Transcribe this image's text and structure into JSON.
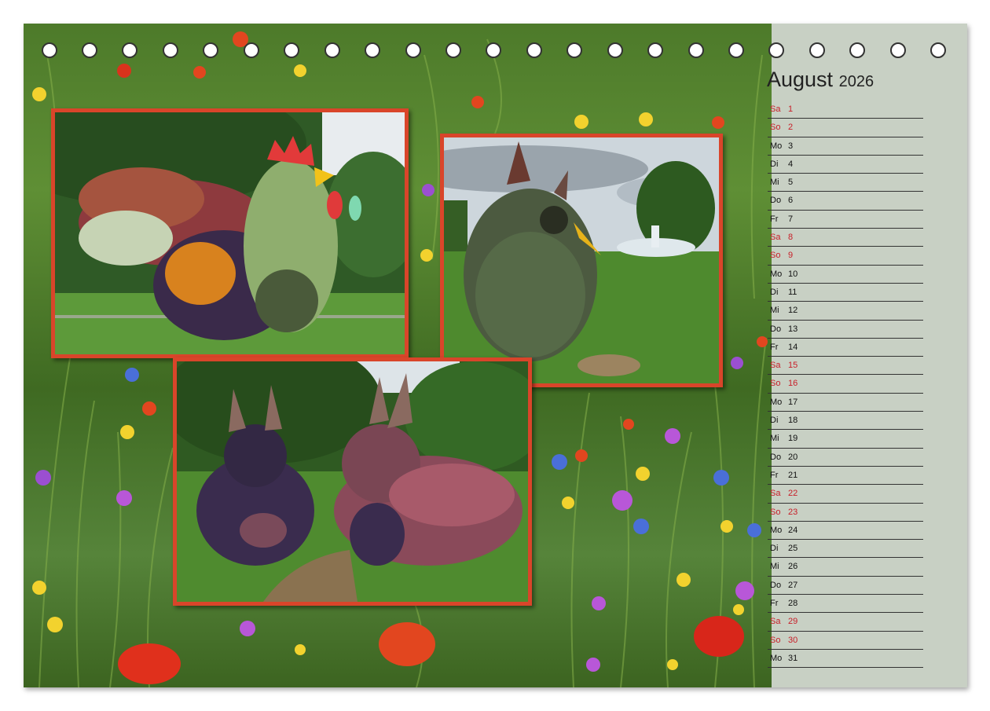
{
  "calendar": {
    "month": "August",
    "year": "2026",
    "days": [
      {
        "dn": "Sa",
        "d": "1",
        "weekend": true
      },
      {
        "dn": "So",
        "d": "2",
        "weekend": true
      },
      {
        "dn": "Mo",
        "d": "3",
        "weekend": false
      },
      {
        "dn": "Di",
        "d": "4",
        "weekend": false
      },
      {
        "dn": "Mi",
        "d": "5",
        "weekend": false
      },
      {
        "dn": "Do",
        "d": "6",
        "weekend": false
      },
      {
        "dn": "Fr",
        "d": "7",
        "weekend": false
      },
      {
        "dn": "Sa",
        "d": "8",
        "weekend": true
      },
      {
        "dn": "So",
        "d": "9",
        "weekend": true
      },
      {
        "dn": "Mo",
        "d": "10",
        "weekend": false
      },
      {
        "dn": "Di",
        "d": "11",
        "weekend": false
      },
      {
        "dn": "Mi",
        "d": "12",
        "weekend": false
      },
      {
        "dn": "Do",
        "d": "13",
        "weekend": false
      },
      {
        "dn": "Fr",
        "d": "14",
        "weekend": false
      },
      {
        "dn": "Sa",
        "d": "15",
        "weekend": true
      },
      {
        "dn": "So",
        "d": "16",
        "weekend": true
      },
      {
        "dn": "Mo",
        "d": "17",
        "weekend": false
      },
      {
        "dn": "Di",
        "d": "18",
        "weekend": false
      },
      {
        "dn": "Mi",
        "d": "19",
        "weekend": false
      },
      {
        "dn": "Do",
        "d": "20",
        "weekend": false
      },
      {
        "dn": "Fr",
        "d": "21",
        "weekend": false
      },
      {
        "dn": "Sa",
        "d": "22",
        "weekend": true
      },
      {
        "dn": "So",
        "d": "23",
        "weekend": true
      },
      {
        "dn": "Mo",
        "d": "24",
        "weekend": false
      },
      {
        "dn": "Di",
        "d": "25",
        "weekend": false
      },
      {
        "dn": "Mi",
        "d": "26",
        "weekend": false
      },
      {
        "dn": "Do",
        "d": "27",
        "weekend": false
      },
      {
        "dn": "Fr",
        "d": "28",
        "weekend": false
      },
      {
        "dn": "Sa",
        "d": "29",
        "weekend": true
      },
      {
        "dn": "So",
        "d": "30",
        "weekend": true
      },
      {
        "dn": "Mo",
        "d": "31",
        "weekend": false
      }
    ]
  },
  "colors": {
    "frame": "#d9452a",
    "sidebar": "#c8d0c4",
    "weekend_text": "#c81e28"
  },
  "photos": [
    {
      "subject": "rooster-topiary"
    },
    {
      "subject": "bird-topiary-with-fountain"
    },
    {
      "subject": "rabbit-topiaries"
    }
  ]
}
